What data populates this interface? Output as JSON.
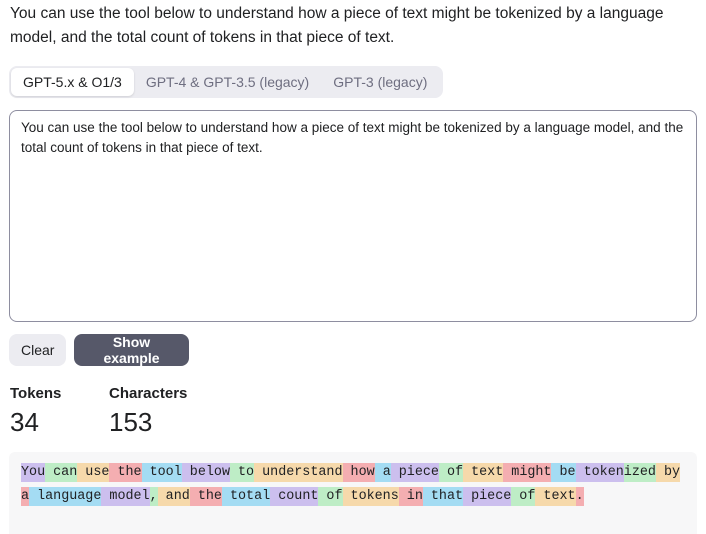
{
  "intro_text": "You can use the tool below to understand how a piece of text might be tokenized by a language model, and the total count of tokens in that piece of text.",
  "tabs": [
    {
      "label": "GPT-5.x & O1/3",
      "active": true
    },
    {
      "label": "GPT-4 & GPT-3.5 (legacy)",
      "active": false
    },
    {
      "label": "GPT-3 (legacy)",
      "active": false
    }
  ],
  "input_text": "You can use the tool below to understand how a piece of text might be tokenized by a language model, and the total count of tokens in that piece of text.",
  "buttons": {
    "clear": "Clear",
    "show_example": "Show example"
  },
  "stats": {
    "tokens_label": "Tokens",
    "tokens_value": "34",
    "characters_label": "Characters",
    "characters_value": "153"
  },
  "tokens": [
    "You",
    " can",
    " use",
    " the",
    " tool",
    " below",
    " to",
    " understand",
    " how",
    " a",
    " piece",
    " of",
    " text",
    " might",
    " be",
    " token",
    "ized",
    " by",
    " a",
    " language",
    " model",
    ",",
    " and",
    " the",
    " total",
    " count",
    " of",
    " tokens",
    " in",
    " that",
    " piece",
    " of",
    " text",
    "."
  ],
  "token_colors": [
    "#6b40d8",
    "#68de7a",
    "#f4ac36",
    "#ef4146",
    "#27b5ea"
  ]
}
